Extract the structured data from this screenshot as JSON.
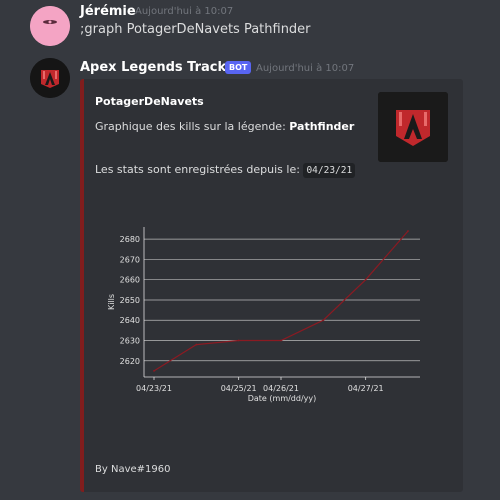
{
  "messages": [
    {
      "username": "Jérémie",
      "timestamp": "Aujourd'hui à 10:07",
      "text": ";graph PotagerDeNavets Pathfinder"
    },
    {
      "username": "Apex Legends Trackers",
      "badge": "BOT",
      "timestamp": "Aujourd'hui à 10:07"
    }
  ],
  "embed": {
    "title": "PotagerDeNavets",
    "desc_prefix": "Graphique des kills sur la légende: ",
    "legend_name": "Pathfinder",
    "stats_prefix": "Les stats sont enregistrées depuis le: ",
    "stats_date": "04/23/21",
    "footer": "By Nave#1960",
    "accent_color": "#811d1d"
  },
  "chart_data": {
    "type": "line",
    "xlabel": "Date (mm/dd/yy)",
    "ylabel": "Kills",
    "x": [
      "04/23/21",
      "04/24/21",
      "04/25/21",
      "04/26/21",
      "04/26/21",
      "04/27/21",
      "04/27/21"
    ],
    "x_tick_labels": [
      "04/23/21",
      "04/25/21",
      "04/26/21",
      "04/27/21"
    ],
    "series": [
      {
        "values": [
          2615,
          2628,
          2630,
          2630,
          2640,
          2660,
          2684
        ],
        "color": "#8b1a22"
      }
    ],
    "y_ticks": [
      2620,
      2630,
      2640,
      2650,
      2660,
      2670,
      2680
    ],
    "ylim": [
      2612,
      2686
    ],
    "grid": true,
    "background": "#2f3136"
  }
}
